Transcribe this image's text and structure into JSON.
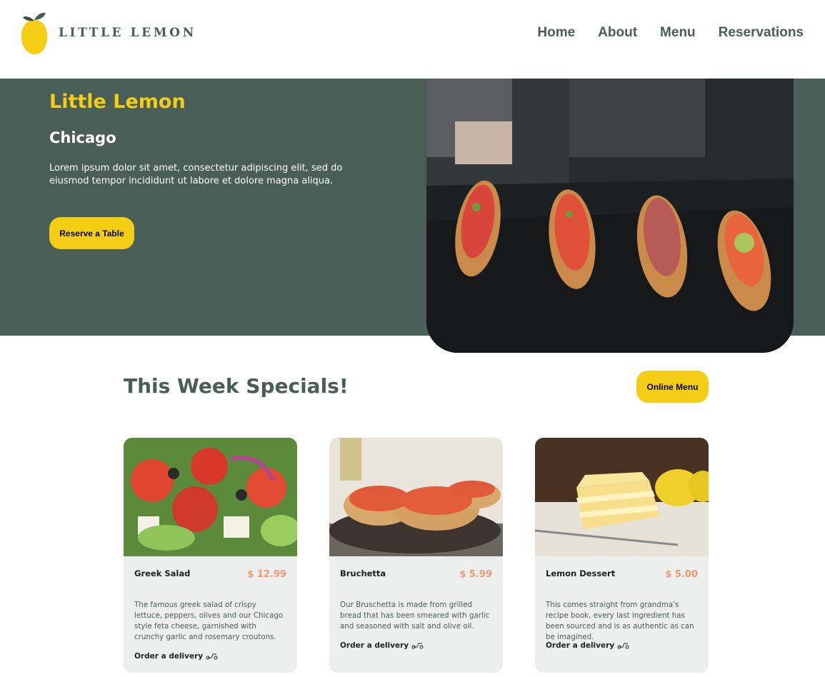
{
  "header": {
    "logo_text": "LITTLE LEMON",
    "nav": [
      "Home",
      "About",
      "Menu",
      "Reservations"
    ]
  },
  "hero": {
    "title": "Little Lemon",
    "city": "Chicago",
    "description": "Lorem ipsum dolor sit amet, consectetur adipiscing elit, sed do eiusmod tempor incididunt ut labore et dolore magna aliqua.",
    "button": "Reserve a Table"
  },
  "specials": {
    "title": "This Week Specials!",
    "button": "Online Menu",
    "items": [
      {
        "name": "Greek Salad",
        "price": "$ 12.99",
        "description": "The famous greek salad of crispy lettuce, peppers, olives and our Chicago style feta cheese, garnished with crunchy garlic and rosemary croutons.",
        "order": "Order a delivery"
      },
      {
        "name": "Bruchetta",
        "price": "$ 5.99",
        "description": "Our Bruschetta is made from grilled bread that has been smeared with garlic and seasoned with salt and olive oil.",
        "order": "Order a delivery"
      },
      {
        "name": "Lemon Dessert",
        "price": "$ 5.00",
        "description": "This comes straight from grandma's recipe book, every last ingredient has been sourced and is as authentic as can be imagined.",
        "order": "Order a delivery"
      }
    ]
  },
  "colors": {
    "primary_green": "#495e57",
    "primary_yellow": "#f4ce14",
    "price_salmon": "#ee9972",
    "card_bg": "#edefee"
  },
  "icons": {
    "logo": "lemon-icon",
    "delivery": "scooter-icon"
  }
}
